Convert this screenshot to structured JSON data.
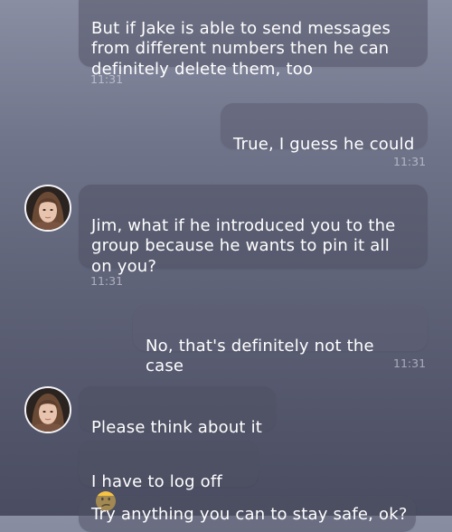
{
  "messages": [
    {
      "text": "But if Jake is able to send messages\nfrom different numbers then he can\ndefinitely delete them, too",
      "time": "11:31"
    },
    {
      "text": "True, I guess he could",
      "time": "11:31"
    },
    {
      "text": "Jim, what if he introduced you to the\ngroup because he wants to pin it all\non you?",
      "time": "11:31"
    },
    {
      "text": "No, that's definitely not the case",
      "time": "11:31"
    },
    {
      "text": "Please think about it"
    },
    {
      "text": "I have to log off",
      "emoji": "confused-face-icon"
    },
    {
      "text": "Try anything you can to stay safe, ok?"
    }
  ],
  "colors": {
    "bubble_text": "#ffffff",
    "timestamp": "#c9cbd6",
    "emoji": "#f6c343"
  }
}
